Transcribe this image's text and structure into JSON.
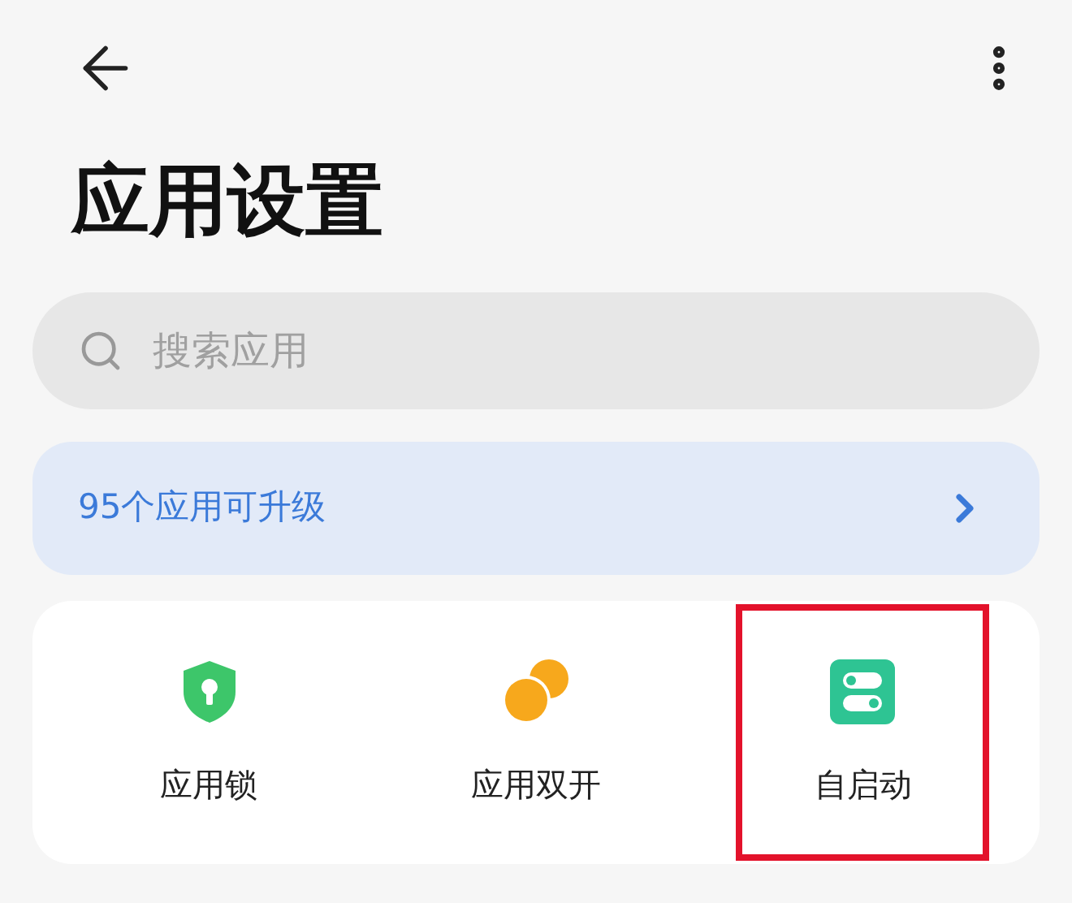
{
  "header": {
    "title": "应用设置"
  },
  "search": {
    "placeholder": "搜索应用"
  },
  "banner": {
    "text": "95个应用可升级"
  },
  "shortcuts": [
    {
      "kind": "lock",
      "label": "应用锁",
      "highlighted": false
    },
    {
      "kind": "dual",
      "label": "应用双开",
      "highlighted": false
    },
    {
      "kind": "autostart",
      "label": "自启动",
      "highlighted": true
    }
  ]
}
